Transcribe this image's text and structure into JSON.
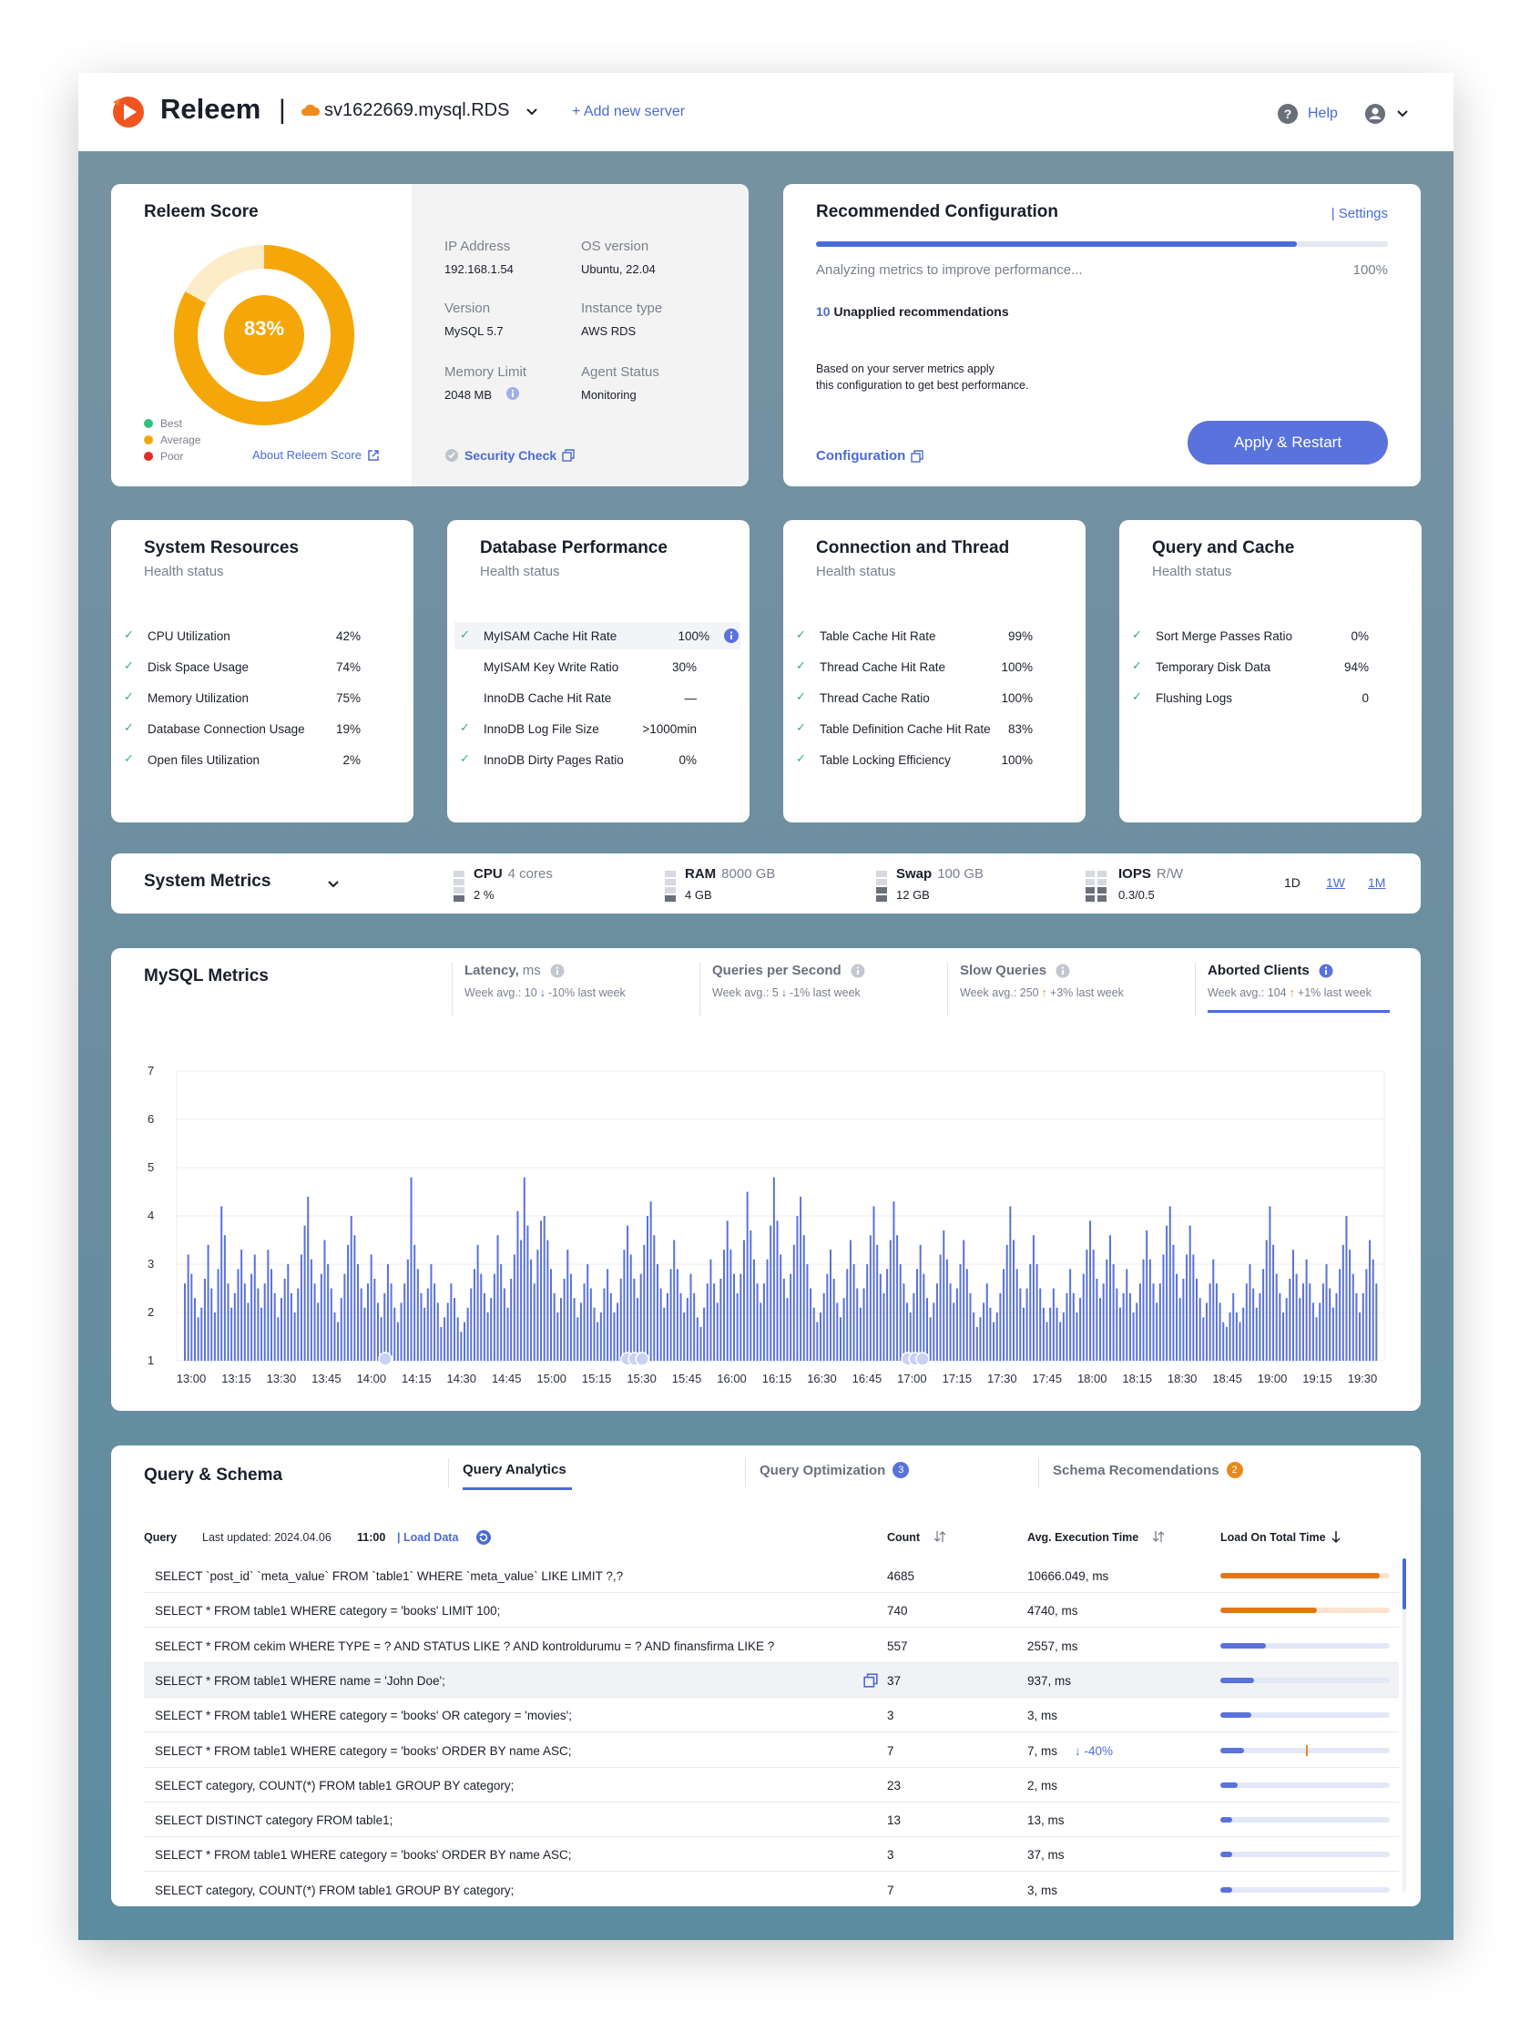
{
  "header": {
    "brand": "Releem",
    "separator": "|",
    "server_name": "sv1622669.mysql.RDS",
    "add_server": "+ Add new server",
    "help": "Help"
  },
  "score": {
    "title": "Releem Score",
    "value": "83%",
    "score_fraction": 0.83,
    "legend": [
      "Best",
      "Average",
      "Poor"
    ],
    "legend_colors": [
      "#2fc27a",
      "#f5a70a",
      "#e02b2b"
    ],
    "about_link": "About Releem Score",
    "security_check": "Security Check"
  },
  "server_info": {
    "ip_label": "IP Address",
    "ip": "192.168.1.54",
    "os_label": "OS version",
    "os": "Ubuntu, 22.04",
    "version_label": "Version",
    "version": "MySQL 5.7",
    "instance_label": "Instance type",
    "instance": "AWS RDS",
    "memory_label": "Memory Limit",
    "memory": "2048 MB",
    "agent_label": "Agent Status",
    "agent": "Monitoring"
  },
  "recommended": {
    "title": "Recommended Configuration",
    "settings_link": "| Settings",
    "progress": 0.84,
    "status": "Analyzing metrics to improve performance...",
    "percent": "100%",
    "unapplied_count": "10",
    "unapplied_label": "Unapplied recommendations",
    "description_1": "Based on your server metrics apply",
    "description_2": "this configuration to get best performance.",
    "config_link": "Configuration",
    "apply_button": "Apply & Restart"
  },
  "health_cards": [
    {
      "title": "System Resources",
      "subtitle": "Health status",
      "rows": [
        {
          "name": "CPU Utilization",
          "value": "42%",
          "check": true
        },
        {
          "name": "Disk Space Usage",
          "value": "74%",
          "check": true
        },
        {
          "name": "Memory Utilization",
          "value": "75%",
          "check": true
        },
        {
          "name": "Database Connection Usage",
          "value": "19%",
          "check": true
        },
        {
          "name": "Open files Utilization",
          "value": "2%",
          "check": true
        }
      ]
    },
    {
      "title": "Database Performance",
      "subtitle": "Health status",
      "rows": [
        {
          "name": "MyISAM Cache Hit Rate",
          "value": "100%",
          "check": true
        },
        {
          "name": "MyISAM Key Write Ratio",
          "value": "30%",
          "check": false
        },
        {
          "name": "InnoDB Cache Hit Rate",
          "value": "—",
          "check": false
        },
        {
          "name": "InnoDB Log File Size",
          "value": ">1000min",
          "check": true
        },
        {
          "name": "InnoDB Dirty Pages Ratio",
          "value": "0%",
          "check": true
        }
      ]
    },
    {
      "title": "Connection and Thread",
      "subtitle": "Health status",
      "rows": [
        {
          "name": "Table Cache Hit Rate",
          "value": "99%",
          "check": true
        },
        {
          "name": "Thread Cache Hit Rate",
          "value": "100%",
          "check": true
        },
        {
          "name": "Thread Cache Ratio",
          "value": "100%",
          "check": true
        },
        {
          "name": "Table Definition Cache Hit Rate",
          "value": "83%",
          "check": true
        },
        {
          "name": "Table Locking Efficiency",
          "value": "100%",
          "check": true
        }
      ]
    },
    {
      "title": "Query and Cache",
      "subtitle": "Health status",
      "rows": [
        {
          "name": "Sort Merge Passes Ratio",
          "value": "0%",
          "check": true
        },
        {
          "name": "Temporary Disk Data",
          "value": "94%",
          "check": true
        },
        {
          "name": "Flushing Logs",
          "value": "0",
          "check": true
        }
      ]
    }
  ],
  "system_metrics": {
    "title": "System Metrics",
    "items": [
      {
        "name": "CPU",
        "capacity": "4 cores",
        "value": "2 %"
      },
      {
        "name": "RAM",
        "capacity": "8000 GB",
        "value": "4 GB"
      },
      {
        "name": "Swap",
        "capacity": "100 GB",
        "value": "12 GB"
      },
      {
        "name": "IOPS",
        "capacity": "R/W",
        "value": "0.3/0.5"
      }
    ],
    "ranges": [
      "1D",
      "1W",
      "1M"
    ]
  },
  "mysql_metrics": {
    "title": "MySQL Metrics",
    "tabs": [
      {
        "name": "Latency,",
        "unit": "ms",
        "avg": "Week avg.: 10",
        "arrow": "↓",
        "change": "-10% last week"
      },
      {
        "name": "Queries per Second",
        "unit": "",
        "avg": "Week avg.: 5",
        "arrow": "↓",
        "change": "-1% last week"
      },
      {
        "name": "Slow Queries",
        "unit": "",
        "avg": "Week avg.: 250",
        "arrow": "↑",
        "change": "+3% last week"
      },
      {
        "name": "Aborted Clients",
        "unit": "",
        "avg": "Week avg.: 104",
        "arrow": "↑",
        "change": "+1% last week"
      }
    ]
  },
  "chart_data": {
    "type": "bar",
    "xlabel": "",
    "ylabel": "",
    "ylim": [
      1,
      7
    ],
    "yticks": [
      "1",
      "2",
      "3",
      "4",
      "5",
      "6",
      "7"
    ],
    "xticks": [
      "13:00",
      "13:15",
      "13:30",
      "13:45",
      "14:00",
      "14:15",
      "14:30",
      "14:45",
      "15:00",
      "15:15",
      "15:30",
      "15:45",
      "16:00",
      "16:15",
      "16:30",
      "16:45",
      "17:00",
      "17:15",
      "17:30",
      "17:45",
      "18:00",
      "18:15",
      "18:30",
      "18:45",
      "19:00",
      "19:15",
      "19:30"
    ],
    "bar_color": "#5a72dc",
    "series": [
      {
        "values": [
          2.6,
          3.2,
          2.8,
          2.3,
          1.9,
          2.1,
          2.7,
          3.4,
          2.5,
          2.0,
          2.9,
          4.2,
          3.6,
          2.6,
          2.1,
          2.4,
          2.9,
          3.3,
          2.6,
          2.2,
          2.8,
          3.2,
          2.5,
          2.1,
          2.6,
          3.3,
          2.9,
          2.4,
          1.9,
          2.3,
          2.7,
          3.0,
          2.4,
          2.0,
          2.5,
          3.2,
          3.8,
          4.4,
          3.1,
          2.6,
          2.2,
          2.8,
          3.5,
          3.0,
          2.5,
          2.0,
          1.8,
          2.3,
          2.8,
          3.4,
          4.0,
          3.6,
          3.0,
          2.5,
          2.1,
          2.6,
          3.2,
          2.7,
          2.2,
          1.9,
          2.4,
          3.0,
          2.6,
          2.1,
          1.8,
          2.2,
          2.6,
          3.1,
          4.8,
          3.4,
          2.9,
          2.4,
          2.1,
          2.5,
          3.0,
          2.6,
          2.2,
          1.7,
          1.9,
          2.2,
          2.6,
          2.3,
          1.9,
          1.6,
          1.8,
          2.1,
          2.5,
          2.9,
          3.4,
          2.8,
          2.4,
          2.0,
          2.3,
          2.8,
          3.6,
          3.0,
          2.5,
          2.1,
          2.7,
          3.2,
          4.1,
          3.5,
          4.8,
          3.8,
          3.1,
          2.6,
          3.3,
          3.9,
          4.0,
          3.5,
          2.9,
          2.4,
          2.0,
          2.3,
          2.7,
          3.3,
          2.8,
          2.3,
          1.9,
          2.2,
          2.6,
          3.0,
          2.5,
          2.1,
          1.8,
          2.0,
          2.5,
          2.9,
          2.4,
          2.0,
          2.2,
          2.7,
          3.3,
          3.8,
          3.2,
          2.7,
          2.3,
          2.8,
          3.4,
          4.0,
          4.3,
          3.6,
          3.0,
          2.5,
          2.1,
          2.4,
          2.9,
          3.5,
          2.9,
          2.4,
          2.0,
          2.3,
          2.8,
          2.4,
          1.9,
          1.7,
          2.1,
          2.6,
          3.1,
          2.6,
          2.2,
          2.7,
          3.3,
          3.9,
          3.3,
          2.8,
          2.4,
          2.8,
          3.5,
          4.5,
          3.7,
          3.1,
          2.6,
          2.2,
          2.6,
          3.1,
          3.8,
          4.8,
          3.9,
          3.2,
          2.7,
          2.3,
          2.8,
          3.4,
          4.0,
          4.4,
          3.6,
          3.0,
          2.5,
          2.1,
          1.8,
          2.0,
          2.4,
          2.8,
          3.3,
          2.7,
          2.2,
          1.9,
          2.3,
          2.9,
          3.5,
          3.0,
          2.5,
          2.1,
          2.5,
          3.0,
          3.6,
          4.2,
          3.4,
          2.8,
          2.4,
          2.9,
          3.5,
          4.3,
          3.6,
          3.0,
          2.6,
          2.2,
          2.0,
          2.4,
          2.9,
          3.4,
          2.8,
          2.3,
          1.9,
          2.2,
          2.6,
          3.2,
          3.7,
          3.1,
          2.6,
          2.2,
          2.5,
          3.0,
          3.5,
          2.9,
          2.4,
          2.0,
          1.7,
          1.9,
          2.2,
          2.6,
          2.1,
          1.8,
          2.0,
          2.4,
          2.9,
          3.4,
          4.2,
          3.5,
          2.9,
          2.5,
          2.1,
          2.5,
          3.0,
          3.6,
          3.0,
          2.5,
          2.1,
          1.8,
          2.1,
          2.5,
          2.1,
          1.8,
          2.0,
          2.4,
          2.9,
          2.4,
          2.0,
          2.3,
          2.8,
          3.3,
          3.9,
          3.3,
          2.7,
          2.3,
          2.6,
          3.1,
          3.6,
          3.0,
          2.5,
          2.1,
          2.4,
          2.9,
          2.4,
          2.0,
          2.2,
          2.6,
          3.1,
          3.7,
          3.1,
          2.6,
          2.2,
          2.6,
          3.2,
          3.8,
          4.2,
          3.4,
          2.8,
          2.3,
          2.7,
          3.2,
          3.8,
          3.2,
          2.7,
          2.3,
          1.9,
          2.2,
          2.6,
          3.1,
          2.6,
          2.2,
          1.8,
          1.7,
          2.0,
          2.4,
          2.0,
          1.8,
          2.1,
          2.6,
          3.0,
          2.5,
          2.1,
          2.4,
          2.9,
          3.5,
          4.2,
          3.4,
          2.8,
          2.4,
          2.0,
          2.3,
          2.7,
          3.3,
          2.8,
          2.3,
          2.6,
          3.1,
          2.6,
          2.2,
          1.9,
          2.2,
          2.6,
          3.0,
          2.5,
          2.1,
          2.4,
          2.9,
          3.4,
          4.0,
          3.3,
          2.8,
          2.4,
          2.0,
          2.4,
          2.9,
          3.5,
          3.1,
          2.6
        ]
      }
    ]
  },
  "query_schema": {
    "title": "Query & Schema",
    "tabs": [
      {
        "label": "Query Analytics",
        "badge": ""
      },
      {
        "label": "Query Optimization",
        "badge": "3"
      },
      {
        "label": "Schema Recomendations",
        "badge": "2"
      }
    ],
    "query_col": "Query",
    "last_updated_label": "Last updated: 2024.04.06",
    "last_updated_time": "11:00",
    "load_data": "| Load Data",
    "count_col": "Count",
    "avg_col": "Avg. Execution Time",
    "load_col": "Load On Total Time",
    "rows": [
      {
        "query": "SELECT `post_id` `meta_value` FROM `table1` WHERE `meta_value` LIKE LIMIT ?,?",
        "count": "4685",
        "avg": "10666.049, ms",
        "delta": "",
        "load": 0.94,
        "color": "#e2761b"
      },
      {
        "query": "SELECT * FROM table1 WHERE category = 'books' LIMIT 100;",
        "count": "740",
        "avg": "4740, ms",
        "delta": "",
        "load": 0.57,
        "color": "#e2761b"
      },
      {
        "query": "SELECT * FROM cekim WHERE TYPE = ? AND STATUS LIKE ? AND kontroldurumu = ? AND finansfirma LIKE ?",
        "count": "557",
        "avg": "2557, ms",
        "delta": "",
        "load": 0.27,
        "color": "#5a72dc"
      },
      {
        "query": "SELECT * FROM table1 WHERE name = 'John Doe';",
        "count": "37",
        "avg": "937, ms",
        "delta": "",
        "load": 0.2,
        "color": "#5a72dc"
      },
      {
        "query": "SELECT * FROM table1 WHERE category = 'books' OR category = 'movies';",
        "count": "3",
        "avg": "3, ms",
        "delta": "",
        "load": 0.18,
        "color": "#5a72dc"
      },
      {
        "query": "SELECT * FROM table1 WHERE category = 'books' ORDER BY name ASC;",
        "count": "7",
        "avg": "7, ms",
        "delta": "↓ -40%",
        "load": 0.14,
        "color": "#5a72dc"
      },
      {
        "query": "SELECT category, COUNT(*) FROM table1 GROUP BY category;",
        "count": "23",
        "avg": "2, ms",
        "delta": "",
        "load": 0.1,
        "color": "#5a72dc"
      },
      {
        "query": "SELECT DISTINCT category FROM table1;",
        "count": "13",
        "avg": "13, ms",
        "delta": "",
        "load": 0.07,
        "color": "#5a72dc"
      },
      {
        "query": "SELECT * FROM table1 WHERE category = 'books' ORDER BY name ASC;",
        "count": "3",
        "avg": "37, ms",
        "delta": "",
        "load": 0.07,
        "color": "#5a72dc"
      },
      {
        "query": "SELECT category, COUNT(*) FROM table1 GROUP BY category;",
        "count": "7",
        "avg": "3, ms",
        "delta": "",
        "load": 0.07,
        "color": "#5a72dc"
      }
    ]
  }
}
